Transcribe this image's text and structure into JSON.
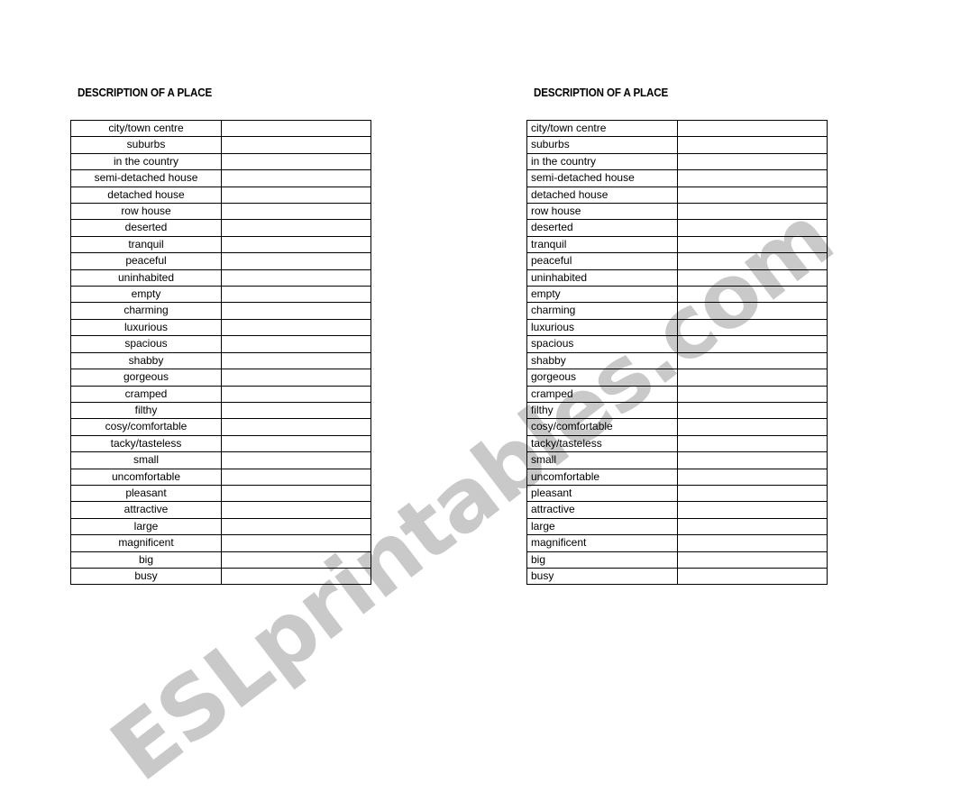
{
  "document": {
    "title": "DESCRIPTION OF A PLACE",
    "watermark": "ESLprintables.com",
    "watermark_color": "#c9c9c9",
    "page_background": "#ffffff",
    "text_color": "#000000"
  },
  "worksheets": [
    {
      "id": "left",
      "heading": "DESCRIPTION OF A PLACE",
      "term_alignment": "center",
      "rows": [
        {
          "term": "city/town centre",
          "answer": ""
        },
        {
          "term": "suburbs",
          "answer": ""
        },
        {
          "term": "in the country",
          "answer": ""
        },
        {
          "term": "semi-detached house",
          "answer": ""
        },
        {
          "term": "detached house",
          "answer": ""
        },
        {
          "term": "row house",
          "answer": ""
        },
        {
          "term": "deserted",
          "answer": ""
        },
        {
          "term": "tranquil",
          "answer": ""
        },
        {
          "term": "peaceful",
          "answer": ""
        },
        {
          "term": "uninhabited",
          "answer": ""
        },
        {
          "term": "empty",
          "answer": ""
        },
        {
          "term": "charming",
          "answer": ""
        },
        {
          "term": "luxurious",
          "answer": ""
        },
        {
          "term": "spacious",
          "answer": ""
        },
        {
          "term": "shabby",
          "answer": ""
        },
        {
          "term": "gorgeous",
          "answer": ""
        },
        {
          "term": "cramped",
          "answer": ""
        },
        {
          "term": "filthy",
          "answer": ""
        },
        {
          "term": "cosy/comfortable",
          "answer": ""
        },
        {
          "term": "tacky/tasteless",
          "answer": ""
        },
        {
          "term": "small",
          "answer": ""
        },
        {
          "term": "uncomfortable",
          "answer": ""
        },
        {
          "term": "pleasant",
          "answer": ""
        },
        {
          "term": "attractive",
          "answer": ""
        },
        {
          "term": "large",
          "answer": ""
        },
        {
          "term": "magnificent",
          "answer": ""
        },
        {
          "term": "big",
          "answer": ""
        },
        {
          "term": "busy",
          "answer": ""
        }
      ]
    },
    {
      "id": "right",
      "heading": "DESCRIPTION OF A PLACE",
      "term_alignment": "left",
      "rows": [
        {
          "term": "city/town centre",
          "answer": ""
        },
        {
          "term": "suburbs",
          "answer": ""
        },
        {
          "term": "in the country",
          "answer": ""
        },
        {
          "term": "semi-detached house",
          "answer": ""
        },
        {
          "term": "detached house",
          "answer": ""
        },
        {
          "term": "row house",
          "answer": ""
        },
        {
          "term": "deserted",
          "answer": ""
        },
        {
          "term": "tranquil",
          "answer": ""
        },
        {
          "term": "peaceful",
          "answer": ""
        },
        {
          "term": "uninhabited",
          "answer": ""
        },
        {
          "term": "empty",
          "answer": ""
        },
        {
          "term": "charming",
          "answer": ""
        },
        {
          "term": "luxurious",
          "answer": ""
        },
        {
          "term": "spacious",
          "answer": ""
        },
        {
          "term": "shabby",
          "answer": ""
        },
        {
          "term": "gorgeous",
          "answer": ""
        },
        {
          "term": "cramped",
          "answer": ""
        },
        {
          "term": "filthy",
          "answer": ""
        },
        {
          "term": "cosy/comfortable",
          "answer": ""
        },
        {
          "term": "tacky/tasteless",
          "answer": ""
        },
        {
          "term": "small",
          "answer": ""
        },
        {
          "term": "uncomfortable",
          "answer": ""
        },
        {
          "term": "pleasant",
          "answer": ""
        },
        {
          "term": "attractive",
          "answer": ""
        },
        {
          "term": "large",
          "answer": ""
        },
        {
          "term": "magnificent",
          "answer": ""
        },
        {
          "term": "big",
          "answer": ""
        },
        {
          "term": "busy",
          "answer": ""
        }
      ]
    }
  ]
}
